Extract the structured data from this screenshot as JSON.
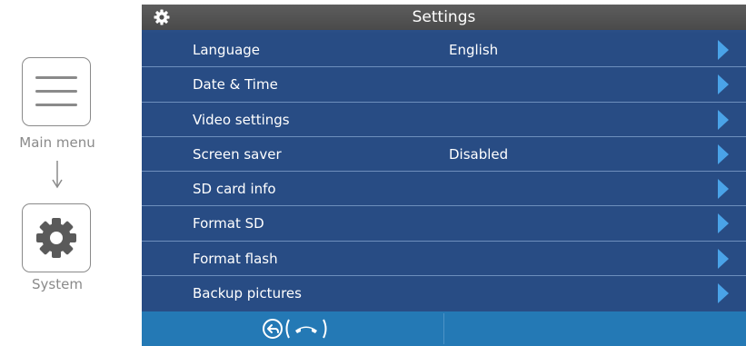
{
  "legend": {
    "menu_label": "Main menu",
    "system_label": "System"
  },
  "screen": {
    "title": "Settings",
    "items": [
      {
        "label": "Language",
        "value": "English"
      },
      {
        "label": "Date & Time",
        "value": ""
      },
      {
        "label": "Video settings",
        "value": ""
      },
      {
        "label": "Screen saver",
        "value": "Disabled"
      },
      {
        "label": "SD card info",
        "value": ""
      },
      {
        "label": "Format SD",
        "value": ""
      },
      {
        "label": "Format flash",
        "value": ""
      },
      {
        "label": "Backup pictures",
        "value": ""
      }
    ]
  },
  "icons": {
    "title": "gear-icon",
    "row_action": "chevron-right-icon",
    "back": "back-arrow-icon",
    "hangup": "phone-hangup-icon"
  },
  "colors": {
    "screen_bg": "#284c84",
    "row_divider": "#6e8fbd",
    "title_bar": "#4f4f4f",
    "bottom_bar": "#2479b5",
    "chevron": "#4aa3e8",
    "legend_gray": "#8a8a8a"
  }
}
